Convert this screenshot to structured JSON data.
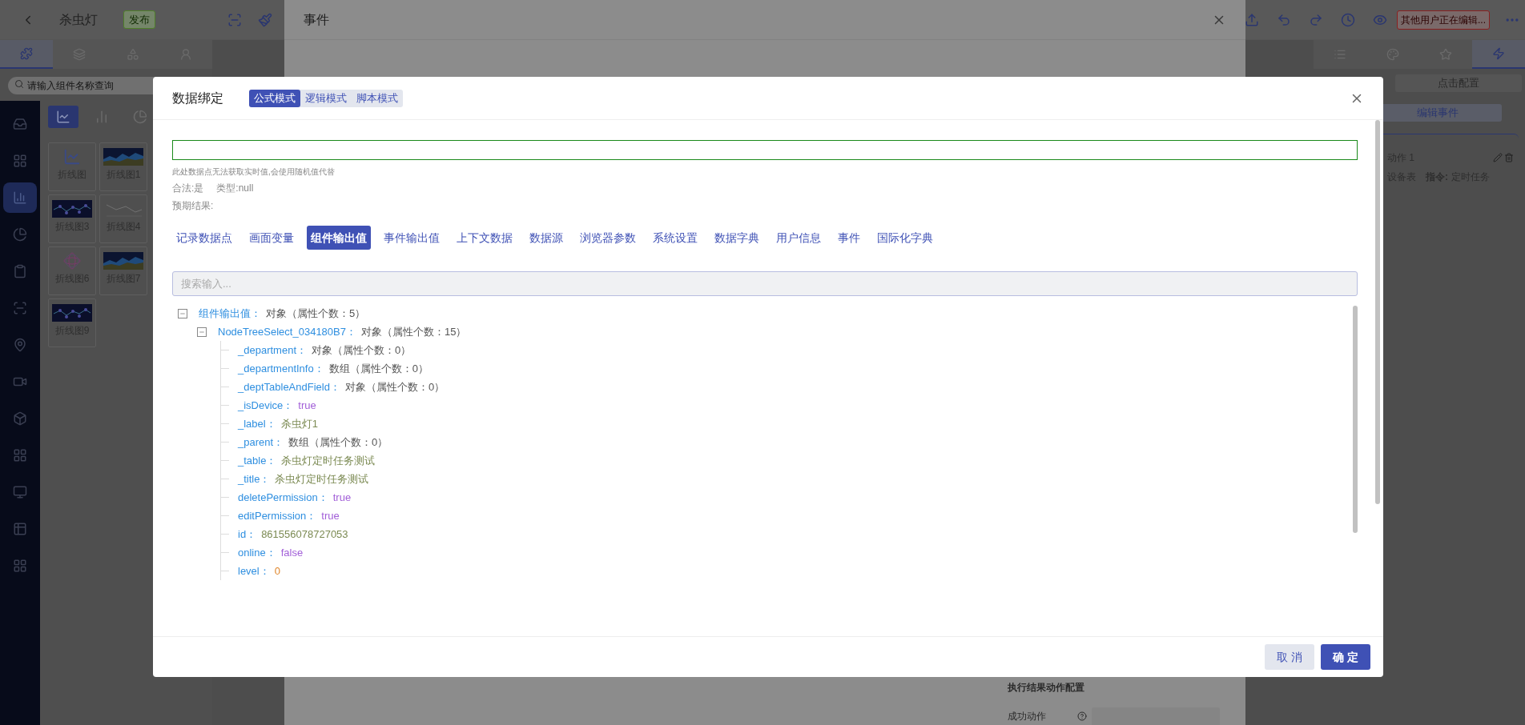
{
  "app": {
    "title": "杀虫灯",
    "publish_badge": "发布",
    "editing_alert": "其他用户正在编辑...",
    "panel_tabs": [
      {
        "selected": true
      },
      {
        "selected": false
      },
      {
        "selected": false
      },
      {
        "selected": false
      }
    ],
    "search_placeholder": "请输入组件名称查询",
    "sidebar": [
      {
        "selected": false
      },
      {
        "selected": false
      },
      {
        "selected": true
      },
      {
        "selected": false
      },
      {
        "selected": false
      },
      {
        "selected": false
      },
      {
        "selected": false
      },
      {
        "selected": false
      },
      {
        "selected": false
      },
      {
        "selected": false
      },
      {
        "selected": false
      },
      {
        "selected": false
      },
      {
        "selected": false
      }
    ],
    "chart_types": [
      {
        "selected": true
      },
      {
        "selected": false
      },
      {
        "selected": false
      }
    ],
    "components": [
      {
        "label": "折线图",
        "kind": "icon"
      },
      {
        "label": "折线图1",
        "kind": "area"
      },
      {
        "label": "折线图3",
        "kind": "dots"
      },
      {
        "label": "折线图4",
        "kind": "light"
      },
      {
        "label": "折线图6",
        "kind": "radial"
      },
      {
        "label": "折线图7",
        "kind": "area"
      },
      {
        "label": "折线图9",
        "kind": "dots"
      }
    ],
    "right_tabs": [
      {
        "selected": false
      },
      {
        "selected": false
      },
      {
        "selected": false
      },
      {
        "selected": true
      }
    ],
    "config_button": "点击配置",
    "edit_event_button": "编辑事件",
    "action": {
      "title": "动作 1",
      "table": "设备表",
      "command_label": "指令:",
      "command": "定时任务"
    }
  },
  "event_modal": {
    "title": "事件",
    "result_section": "执行结果动作配置",
    "success_label": "成功动作"
  },
  "dialog": {
    "title": "数据绑定",
    "modes": [
      {
        "label": "公式模式",
        "selected": true
      },
      {
        "label": "逻辑模式",
        "selected": false
      },
      {
        "label": "脚本模式",
        "selected": false
      }
    ],
    "hint": "此处数据点无法获取实时值,会使用随机值代替",
    "valid": "合法:是",
    "type": "类型:null",
    "expected": "预期结果:",
    "sources": [
      {
        "label": "记录数据点",
        "selected": false
      },
      {
        "label": "画面变量",
        "selected": false
      },
      {
        "label": "组件输出值",
        "selected": true
      },
      {
        "label": "事件输出值",
        "selected": false
      },
      {
        "label": "上下文数据",
        "selected": false
      },
      {
        "label": "数据源",
        "selected": false
      },
      {
        "label": "浏览器参数",
        "selected": false
      },
      {
        "label": "系统设置",
        "selected": false
      },
      {
        "label": "数据字典",
        "selected": false
      },
      {
        "label": "用户信息",
        "selected": false
      },
      {
        "label": "事件",
        "selected": false
      },
      {
        "label": "国际化字典",
        "selected": false
      }
    ],
    "search_placeholder": "搜索输入...",
    "tree": [
      {
        "key": "组件输出值：",
        "value": "对象（属性个数：5）",
        "kind": "object",
        "expanded": true,
        "children": [
          {
            "key": "NodeTreeSelect_034180B7：",
            "value": "对象（属性个数：15）",
            "kind": "object",
            "expanded": true,
            "children": [
              {
                "key": "_department：",
                "value": "对象（属性个数：0）",
                "kind": "object"
              },
              {
                "key": "_departmentInfo：",
                "value": "数组（属性个数：0）",
                "kind": "object"
              },
              {
                "key": "_deptTableAndField：",
                "value": "对象（属性个数：0）",
                "kind": "object"
              },
              {
                "key": "_isDevice：",
                "value": "true",
                "kind": "boolean"
              },
              {
                "key": "_label：",
                "value": "杀虫灯1",
                "kind": "string"
              },
              {
                "key": "_parent：",
                "value": "数组（属性个数：0）",
                "kind": "object"
              },
              {
                "key": "_table：",
                "value": "杀虫灯定时任务测试",
                "kind": "string"
              },
              {
                "key": "_title：",
                "value": "杀虫灯定时任务测试",
                "kind": "string"
              },
              {
                "key": "deletePermission：",
                "value": "true",
                "kind": "boolean"
              },
              {
                "key": "editPermission：",
                "value": "true",
                "kind": "boolean"
              },
              {
                "key": "id：",
                "value": "861556078727053",
                "kind": "string"
              },
              {
                "key": "online：",
                "value": "false",
                "kind": "boolean"
              },
              {
                "key": "level：",
                "value": "0",
                "kind": "number"
              }
            ]
          }
        ]
      }
    ],
    "cancel_button": "取消",
    "ok_button": "确定"
  }
}
